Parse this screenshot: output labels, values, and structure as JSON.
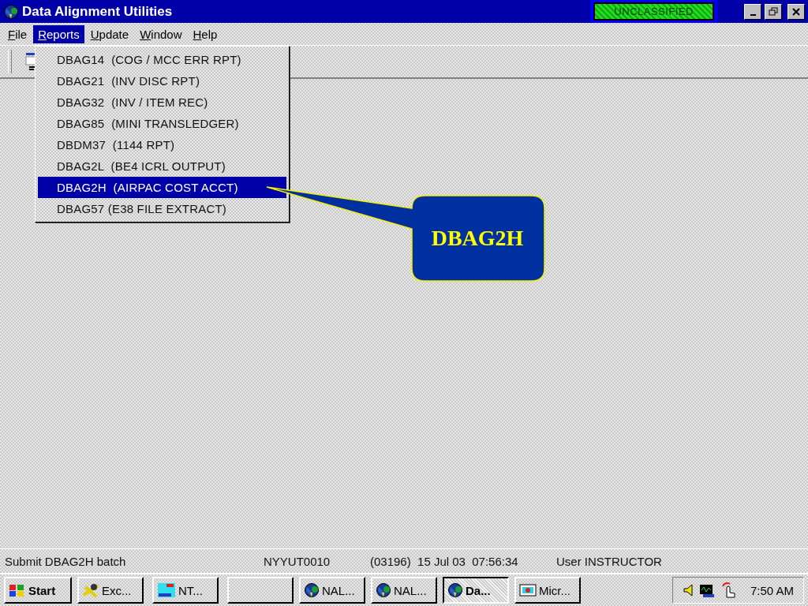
{
  "window": {
    "title": "Data Alignment Utilities",
    "classification": "UNCLASSIFIED"
  },
  "menu": [
    {
      "label": "File",
      "selected": false
    },
    {
      "label": "Reports",
      "selected": true
    },
    {
      "label": "Update",
      "selected": false
    },
    {
      "label": "Window",
      "selected": false
    },
    {
      "label": "Help",
      "selected": false
    }
  ],
  "dropdown": [
    {
      "label": "DBAG14  (COG / MCC ERR RPT)",
      "selected": false
    },
    {
      "label": "DBAG21  (INV DISC RPT)",
      "selected": false
    },
    {
      "label": "DBAG32  (INV / ITEM REC)",
      "selected": false
    },
    {
      "label": "DBAG85  (MINI TRANSLEDGER)",
      "selected": false
    },
    {
      "label": "DBDM37  (1144 RPT)",
      "selected": false
    },
    {
      "label": "DBAG2L  (BE4 ICRL OUTPUT)",
      "selected": false
    },
    {
      "label": "DBAG2H  (AIRPAC COST ACCT)",
      "selected": true
    },
    {
      "label": "DBAG57 (E38 FILE EXTRACT)",
      "selected": false
    }
  ],
  "callout": {
    "text": "DBAG2H"
  },
  "status_bar": {
    "message": "Submit DBAG2H batch",
    "terminal": "NYYUT0010",
    "timestamp": "(03196)  15 Jul 03  07:56:34",
    "user": "User INSTRUCTOR"
  },
  "taskbar": {
    "start": "Start",
    "buttons": [
      {
        "label": "Exc...",
        "kind": "excel",
        "pressed": false
      },
      {
        "label": "NT...",
        "kind": "nt",
        "pressed": false
      },
      {
        "kind": "blank",
        "pressed": false
      },
      {
        "label": "NAL...",
        "kind": "globe",
        "pressed": false
      },
      {
        "label": "NAL...",
        "kind": "globe",
        "pressed": false
      },
      {
        "label": "Da...",
        "kind": "globe",
        "pressed": true
      },
      {
        "label": "Micr...",
        "kind": "ppt",
        "pressed": false
      }
    ],
    "clock": "7:50 AM"
  }
}
